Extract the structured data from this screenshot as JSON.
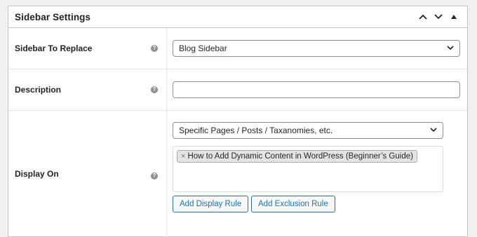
{
  "panel": {
    "title": "Sidebar Settings",
    "controls": [
      "move-up-icon",
      "move-down-icon",
      "toggle-panel-icon"
    ]
  },
  "rows": {
    "sidebar_to_replace": {
      "label": "Sidebar To Replace",
      "help": "?",
      "value": "Blog Sidebar"
    },
    "description": {
      "label": "Description",
      "help": "?",
      "value": ""
    },
    "display_on": {
      "label": "Display On",
      "help": "?",
      "select_value": "Specific Pages / Posts / Taxanomies, etc.",
      "tags": [
        "How to Add Dynamic Content in WordPress (Beginner’s Guide)"
      ],
      "tag_remove_symbol": "×",
      "add_display_rule": "Add Display Rule",
      "add_exclusion_rule": "Add Exclusion Rule"
    }
  }
}
